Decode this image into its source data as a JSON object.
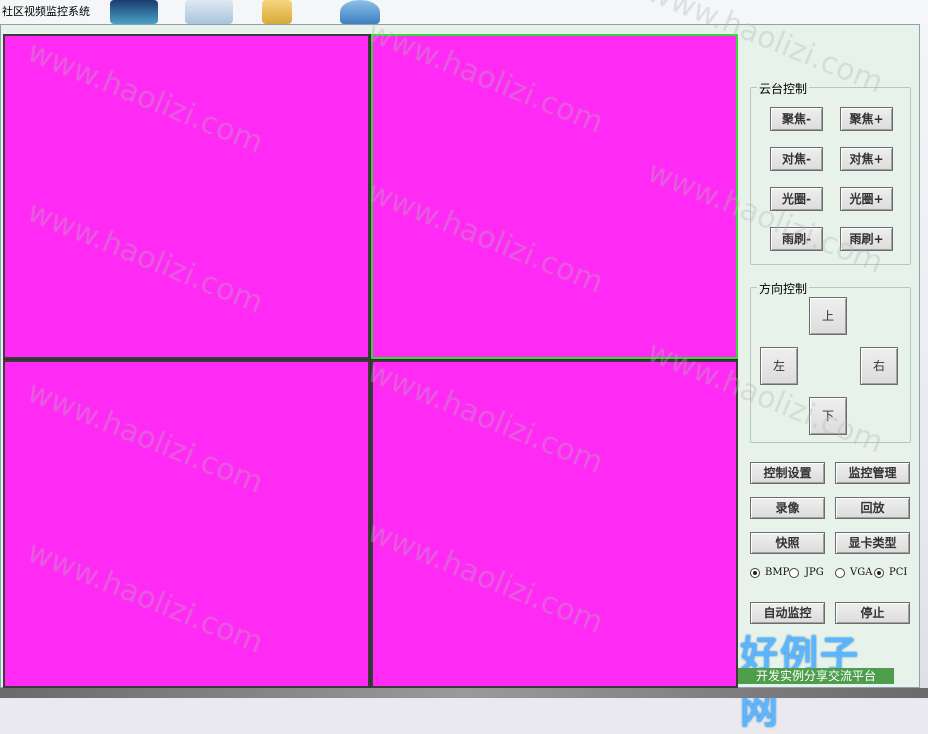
{
  "window": {
    "title": "社区视频监控系统"
  },
  "video": {
    "cells": [
      {
        "name": "video-cell-1",
        "selected": false
      },
      {
        "name": "video-cell-2",
        "selected": true
      },
      {
        "name": "video-cell-3",
        "selected": false
      },
      {
        "name": "video-cell-4",
        "selected": false
      }
    ],
    "fill_color": "#ff2bf5",
    "selected_border_color": "#38d638"
  },
  "ptz": {
    "label": "云台控制",
    "focus_minus": "聚焦-",
    "focus_plus": "聚焦+",
    "adjust_minus": "对焦-",
    "adjust_plus": "对焦+",
    "iris_minus": "光圈-",
    "iris_plus": "光圈+",
    "wiper_minus": "雨刷-",
    "wiper_plus": "雨刷+"
  },
  "direction": {
    "label": "方向控制",
    "up": "上",
    "down": "下",
    "left": "左",
    "right": "右"
  },
  "actions": {
    "control_settings": "控制设置",
    "monitor_management": "监控管理",
    "record": "录像",
    "playback": "回放",
    "snapshot": "快照",
    "card_type": "显卡类型",
    "auto_monitor": "自动监控",
    "stop": "停止"
  },
  "capture_format": {
    "options": [
      "BMP",
      "JPG"
    ],
    "selected": "BMP"
  },
  "card_type_options": {
    "options": [
      "VGA",
      "PCI"
    ],
    "selected": "PCI"
  },
  "watermark": {
    "text": "www.haolizi.com"
  },
  "brand": {
    "title": "好例子网",
    "subtitle": "开发实例分享交流平台"
  }
}
